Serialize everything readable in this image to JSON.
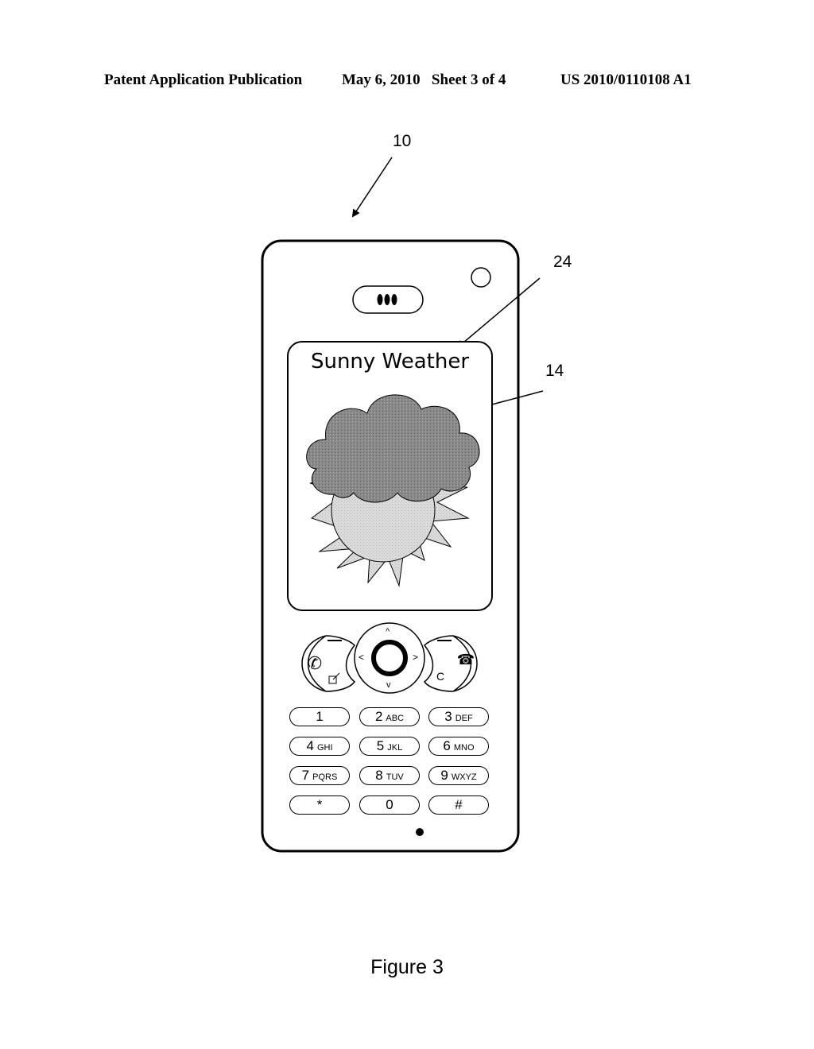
{
  "header": {
    "publication": "Patent Application Publication",
    "date_sheet": "May 6, 2010   Sheet 3 of 4",
    "number": "US 2010/0110108 A1"
  },
  "reference_numerals": {
    "device": "10",
    "title_text": "24",
    "image": "14"
  },
  "screen": {
    "title": "Sunny Weather",
    "image_description": "cloud partially covering sun"
  },
  "nav": {
    "up": "^",
    "down": "v",
    "left": "<",
    "right": ">",
    "clear": "C"
  },
  "keypad": [
    {
      "digit": "1",
      "letters": ""
    },
    {
      "digit": "2",
      "letters": "ABC"
    },
    {
      "digit": "3",
      "letters": "DEF"
    },
    {
      "digit": "4",
      "letters": "GHI"
    },
    {
      "digit": "5",
      "letters": "JKL"
    },
    {
      "digit": "6",
      "letters": "MNO"
    },
    {
      "digit": "7",
      "letters": "PQRS"
    },
    {
      "digit": "8",
      "letters": "TUV"
    },
    {
      "digit": "9",
      "letters": "WXYZ"
    },
    {
      "digit": "*",
      "letters": ""
    },
    {
      "digit": "0",
      "letters": ""
    },
    {
      "digit": "#",
      "letters": ""
    }
  ],
  "caption": "Figure 3"
}
